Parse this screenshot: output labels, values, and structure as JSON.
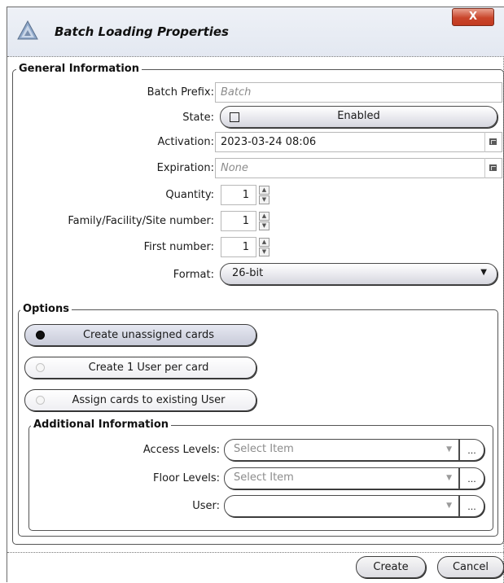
{
  "window": {
    "title": "Batch Loading Properties",
    "close_label": "X"
  },
  "general": {
    "title": "General Information",
    "batch_prefix_label": "Batch Prefix:",
    "batch_prefix_placeholder": "Batch",
    "state_label": "State:",
    "state_value": "Enabled",
    "activation_label": "Activation:",
    "activation_value": "2023-03-24 08:06",
    "expiration_label": "Expiration:",
    "expiration_placeholder": "None",
    "quantity_label": "Quantity:",
    "quantity_value": "1",
    "facility_label": "Family/Facility/Site number:",
    "facility_value": "1",
    "first_number_label": "First number:",
    "first_number_value": "1",
    "format_label": "Format:",
    "format_value": "26-bit"
  },
  "options": {
    "title": "Options",
    "items": [
      {
        "label": "Create unassigned cards",
        "selected": true
      },
      {
        "label": "Create 1 User per card",
        "selected": false
      },
      {
        "label": "Assign cards to existing User",
        "selected": false
      }
    ]
  },
  "additional": {
    "title": "Additional Information",
    "access_levels_label": "Access Levels:",
    "access_levels_placeholder": "Select Item",
    "floor_levels_label": "Floor Levels:",
    "floor_levels_placeholder": "Select Item",
    "user_label": "User:",
    "user_value": "",
    "browse_label": "..."
  },
  "footer": {
    "create_label": "Create",
    "cancel_label": "Cancel"
  }
}
